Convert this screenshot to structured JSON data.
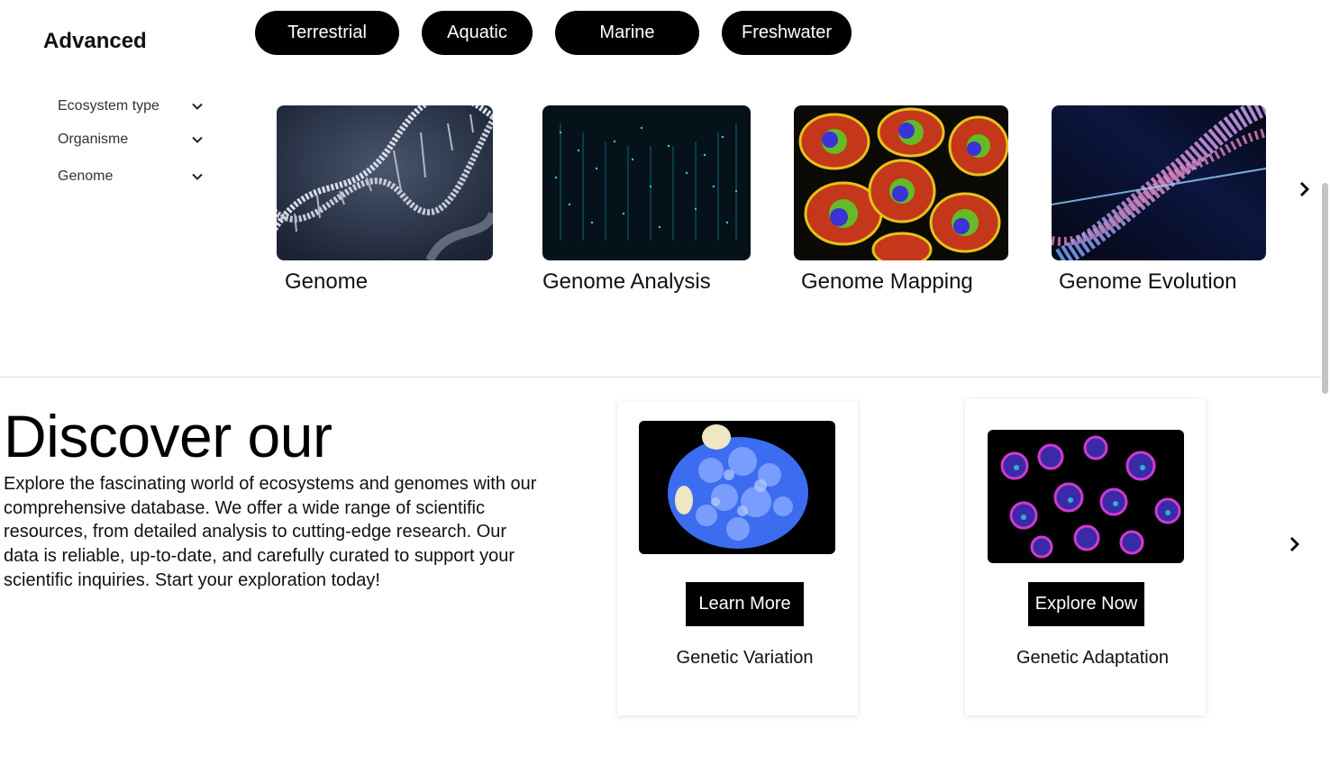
{
  "sidebar": {
    "title": "Advanced",
    "filters": [
      {
        "label": "Ecosystem type",
        "icon": "chevron-down-icon"
      },
      {
        "label": "Organisme",
        "icon": "chevron-down-icon"
      },
      {
        "label": "Genome",
        "icon": "chevron-down-icon"
      }
    ]
  },
  "tags": [
    "Terrestrial",
    "Aquatic",
    "Marine",
    "Freshwater"
  ],
  "genome_cards": [
    {
      "label": "Genome",
      "image": "dna-helix-image"
    },
    {
      "label": "Genome Analysis",
      "image": "data-particles-image"
    },
    {
      "label": "Genome Mapping",
      "image": "fluorescent-cells-image"
    },
    {
      "label": "Genome Evolution",
      "image": "dna-particles-image"
    }
  ],
  "discover": {
    "title": "Discover our",
    "description": "Explore the fascinating world of ecosystems and genomes with our comprehensive database. We offer a wide range of scientific resources, from detailed analysis to cutting-edge research. Our data is reliable, up-to-date, and carefully curated to support your scientific inquiries. Start your exploration today!"
  },
  "feature_cards": [
    {
      "button": "Learn More",
      "caption": "Genetic Variation",
      "image": "blue-cell-image"
    },
    {
      "button": "Explore Now",
      "caption": "Genetic Adaptation",
      "image": "stained-nuclei-image"
    }
  ],
  "icons": {
    "next": "chevron-right-icon"
  },
  "colors": {
    "accent": "#000000",
    "background": "#ffffff"
  }
}
